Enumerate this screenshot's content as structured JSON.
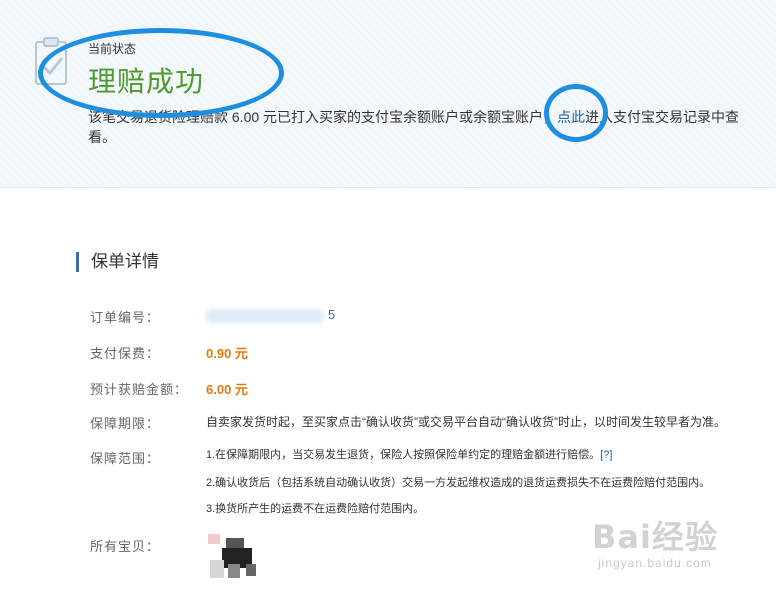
{
  "status": {
    "label": "当前状态",
    "title": "理赔成功",
    "desc_before": "该笔交易退货险理赔款 6.00 元已打入买家的支付宝余额账户或余额宝账户，",
    "link_text": "点此",
    "desc_after": "进入支付宝交易记录中查看。"
  },
  "policy": {
    "section_title": "保单详情",
    "order_label": "订单编号：",
    "order_suffix": "5",
    "fee_label": "支付保费：",
    "fee_value": "0.90 元",
    "claim_label": "预计获赔金额：",
    "claim_value": "6.00 元",
    "period_label": "保障期限：",
    "period_value": "自卖家发货时起，至买家点击“确认收货”或交易平台自动“确认收货”时止，以时间发生较早者为准。",
    "scope_label": "保障范围：",
    "scope_items": [
      "1.在保障期限内，当交易发生退货，保险人按照保险单约定的理赔金额进行赔偿。",
      "2.确认收货后（包括系统自动确认收货）交易一方发起维权造成的退货运费损失不在运费险赔付范围内。",
      "3.换货所产生的运费不在运费险赔付范围内。"
    ],
    "help_text": "[?]",
    "items_label": "所有宝贝："
  },
  "watermark": {
    "main": "Bai经验",
    "sub": "jingyan.baidu.com"
  },
  "colors": {
    "success": "#4e9a2e",
    "price": "#e07a10",
    "link": "#1e5fa8",
    "annotation": "#1e8fe0"
  },
  "icons": {
    "status": "clipboard-check-icon",
    "product": "product-thumbnail"
  }
}
